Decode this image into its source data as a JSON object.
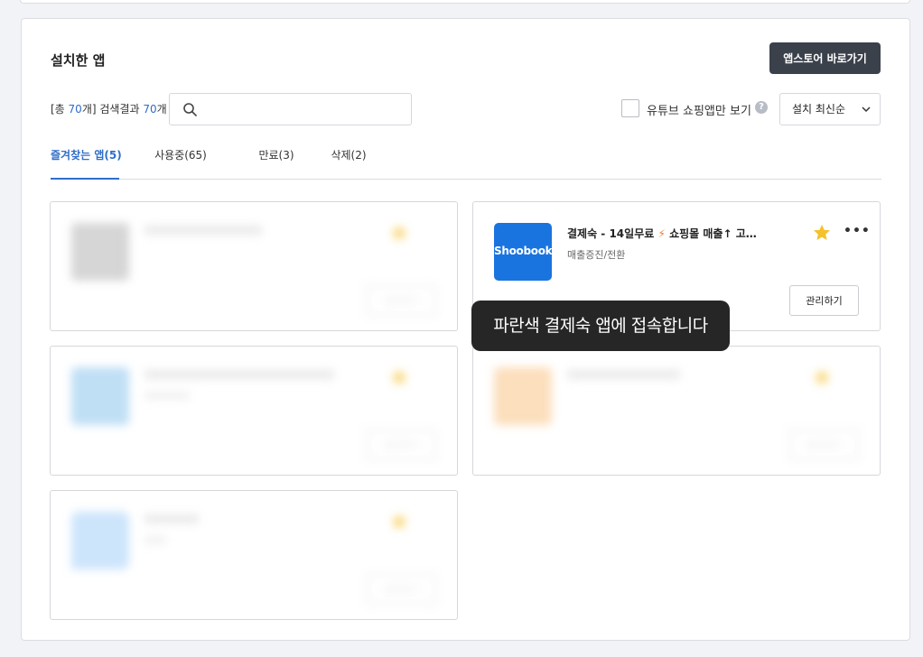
{
  "title": "설치한 앱",
  "store_button": "앱스토어 바로가기",
  "count": {
    "prefix": "[총 ",
    "total": "70",
    "middle": "개] 검색결과 ",
    "results": "70",
    "suffix": "개"
  },
  "search": {
    "value": "",
    "placeholder": ""
  },
  "youtube_filter": {
    "label": "유튜브 쇼핑앱만 보기",
    "checked": false,
    "help": "?"
  },
  "sort": {
    "selected": "설치 최신순"
  },
  "tabs": [
    {
      "label": "즐겨찾는 앱(5)",
      "active": true
    },
    {
      "label": "사용중(65)",
      "active": false
    },
    {
      "label": "만료(3)",
      "active": false
    },
    {
      "label": "삭제(2)",
      "active": false
    }
  ],
  "cards": [
    {
      "name": "",
      "category": "",
      "icon_color": "#c8c8c8",
      "blurred": true,
      "favorite": true,
      "manage_label": "관리하기"
    },
    {
      "name": "결제숙 - 14일무료",
      "name_suffix": "쇼핑몰 매출↑ 고…",
      "category": "매출증진/전환",
      "icon_color": "#1a74e0",
      "logo": "Shoobook",
      "blurred": false,
      "favorite": true,
      "manage_label": "관리하기"
    },
    {
      "name": "",
      "category": "",
      "icon_color": "#aad4f2",
      "blurred": true,
      "favorite": true,
      "manage_label": "관리하기"
    },
    {
      "name": "",
      "category": "",
      "icon_color": "#fbd4a6",
      "blurred": true,
      "favorite": true,
      "manage_label": "관리하기"
    },
    {
      "name": "",
      "category": "",
      "icon_color": "#bcdcfa",
      "blurred": true,
      "favorite": true,
      "manage_label": "관리하기"
    }
  ],
  "tooltip": "파란색 결제숙 앱에 접속합니다",
  "colors": {
    "accent": "#2f6ec9",
    "star": "#f5c12c",
    "dark_button": "#3b414b"
  }
}
